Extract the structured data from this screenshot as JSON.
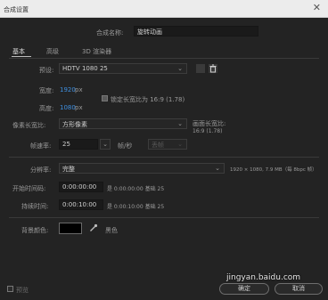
{
  "window": {
    "title": "合成设置",
    "close_glyph": "✕"
  },
  "comp_name": {
    "label": "合成名称:",
    "value": "旋转动画"
  },
  "tabs": [
    {
      "label": "基本"
    },
    {
      "label": "高级"
    },
    {
      "label": "3D 渲染器"
    }
  ],
  "preset": {
    "label": "预设:",
    "value": "HDTV 1080 25"
  },
  "width": {
    "label": "宽度:",
    "value": "1920",
    "unit": "px"
  },
  "height": {
    "label": "高度:",
    "value": "1080",
    "unit": "px"
  },
  "lock_aspect": {
    "label": "锁定长宽比为 16:9 (1.78)",
    "checked": true
  },
  "pixel_aspect": {
    "label": "像素长宽比:",
    "value": "方形像素"
  },
  "frame_aspect": {
    "label": "画面长宽比:",
    "value": "16:9 (1.78)"
  },
  "frame_rate": {
    "label": "帧速率:",
    "value": "25",
    "unit": "帧/秒",
    "drop_frame": "丢帧"
  },
  "resolution": {
    "label": "分辨率:",
    "value": "完整",
    "info": "1920 × 1080, 7.9 MB（每 8bpc 帧）"
  },
  "start_timecode": {
    "label": "开始时间码:",
    "value": "0:00:00:00",
    "info": "是 0:00:00:00 基础 25"
  },
  "duration": {
    "label": "持续时间:",
    "value": "0:00:10:00",
    "info": "是 0:00:10:00 基础 25"
  },
  "bg_color": {
    "label": "背景颜色:",
    "name": "黑色",
    "swatch": "#000000"
  },
  "preview": {
    "label": "预览"
  },
  "buttons": {
    "ok": "确定",
    "cancel": "取消"
  },
  "watermark": "jingyan.baidu.com",
  "colors": {
    "accent": "#3f8fe0",
    "dialog_bg": "#232323"
  },
  "icons": [
    "close-icon",
    "chevron-down-icon",
    "save-preset-icon",
    "delete-preset-icon",
    "eyedropper-icon",
    "link-checkbox-icon"
  ]
}
